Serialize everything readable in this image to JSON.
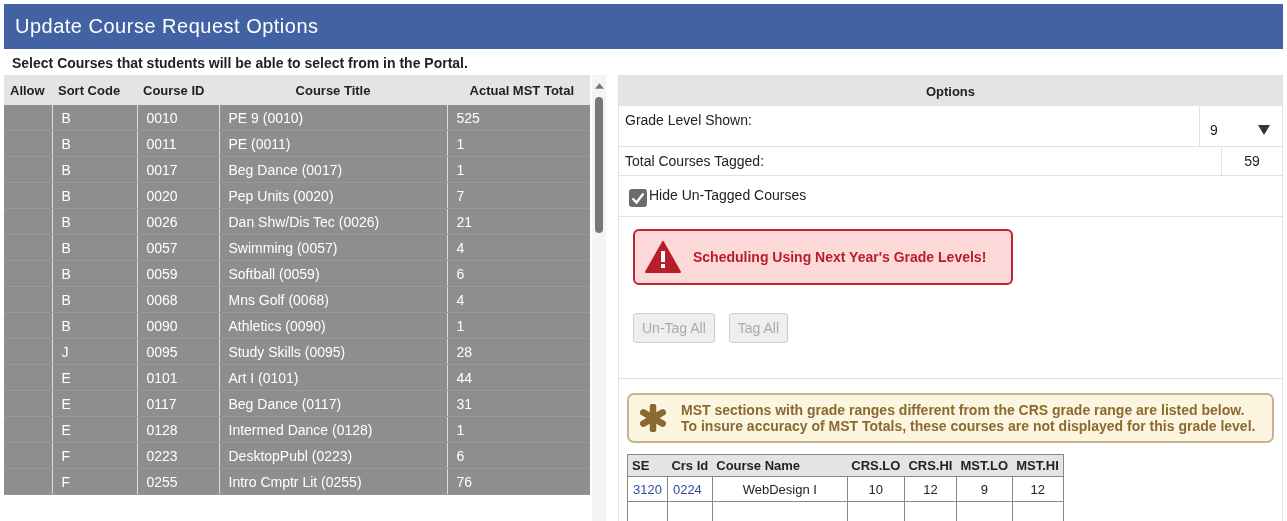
{
  "window": {
    "title": "Update Course Request Options"
  },
  "instructions": "Select Courses that students will be able to select from in the Portal.",
  "course_table": {
    "columns": [
      "Allow",
      "Sort Code",
      "Course ID",
      "Course Title",
      "Actual MST Total"
    ],
    "rows": [
      {
        "sort_code": "B",
        "course_id": "0010",
        "title": "PE 9 (0010)",
        "total": "525"
      },
      {
        "sort_code": "B",
        "course_id": "0011",
        "title": "PE (0011)",
        "total": "1"
      },
      {
        "sort_code": "B",
        "course_id": "0017",
        "title": "Beg Dance (0017)",
        "total": "1"
      },
      {
        "sort_code": "B",
        "course_id": "0020",
        "title": "Pep Units (0020)",
        "total": "7"
      },
      {
        "sort_code": "B",
        "course_id": "0026",
        "title": "Dan Shw/Dis Tec (0026)",
        "total": "21"
      },
      {
        "sort_code": "B",
        "course_id": "0057",
        "title": "Swimming (0057)",
        "total": "4"
      },
      {
        "sort_code": "B",
        "course_id": "0059",
        "title": "Softball (0059)",
        "total": "6"
      },
      {
        "sort_code": "B",
        "course_id": "0068",
        "title": "Mns Golf (0068)",
        "total": "4"
      },
      {
        "sort_code": "B",
        "course_id": "0090",
        "title": "Athletics (0090)",
        "total": "1"
      },
      {
        "sort_code": "J",
        "course_id": "0095",
        "title": "Study Skills (0095)",
        "total": "28"
      },
      {
        "sort_code": "E",
        "course_id": "0101",
        "title": "Art I (0101)",
        "total": "44"
      },
      {
        "sort_code": "E",
        "course_id": "0117",
        "title": "Beg Dance (0117)",
        "total": "31"
      },
      {
        "sort_code": "E",
        "course_id": "0128",
        "title": "Intermed Dance (0128)",
        "total": "1"
      },
      {
        "sort_code": "F",
        "course_id": "0223",
        "title": "DesktopPubl (0223)",
        "total": "6"
      },
      {
        "sort_code": "F",
        "course_id": "0255",
        "title": "Intro Cmptr Lit (0255)",
        "total": "76"
      }
    ]
  },
  "options": {
    "header": "Options",
    "grade_level": {
      "label": "Grade Level Shown:",
      "value": "9"
    },
    "total_tagged": {
      "label": "Total Courses Tagged:",
      "value": "59"
    },
    "hide_untagged": {
      "label": "Hide Un-Tagged Courses",
      "checked": true
    },
    "alert": "Scheduling Using Next Year's Grade Levels!",
    "buttons": [
      {
        "label": "Un-Tag All",
        "disabled": true
      },
      {
        "label": "Tag All",
        "disabled": true
      }
    ],
    "notice": [
      "MST sections with grade ranges different from the CRS grade range are listed below.",
      "To insure accuracy of MST Totals, these courses are not displayed for this grade level."
    ],
    "mst_table": {
      "columns": [
        "SE",
        "Crs Id",
        "Course Name",
        "CRS.LO",
        "CRS.HI",
        "MST.LO",
        "MST.HI"
      ],
      "rows": [
        {
          "se": "3120",
          "crs_id": "0224",
          "name": "WebDesign I",
          "crs_lo": "10",
          "crs_hi": "12",
          "mst_lo": "9",
          "mst_hi": "12"
        }
      ]
    }
  }
}
